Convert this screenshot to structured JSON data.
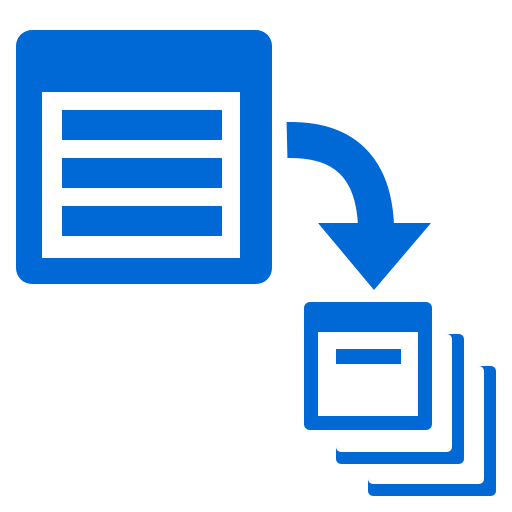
{
  "icon": {
    "primary_color": "#0069D5",
    "background_color": "#FFFFFF",
    "elements": [
      "source-window-icon",
      "curved-arrow-icon",
      "stacked-windows-icon"
    ]
  }
}
